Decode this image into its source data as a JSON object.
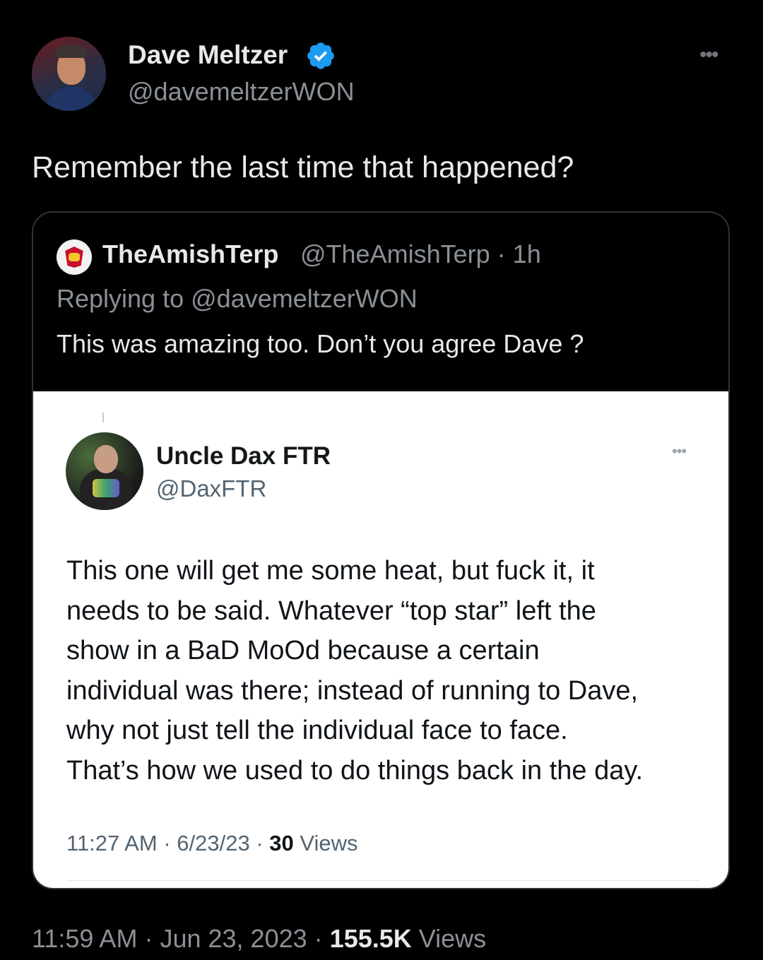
{
  "tweet": {
    "author_name": "Dave Meltzer",
    "author_handle": "@davemeltzerWON",
    "verified": true,
    "text": "Remember the last time that happened?",
    "time": "11:59 AM",
    "date": "Jun 23, 2023",
    "views_count": "155.5K",
    "views_label": "Views",
    "separator": "·"
  },
  "quote": {
    "author_name": "TheAmishTerp",
    "author_handle": "@TheAmishTerp",
    "age": "1h",
    "reply_prefix": "Replying to",
    "reply_to": "@davemeltzerWON",
    "text": "This was amazing too. Don’t you agree Dave ?"
  },
  "embedded": {
    "author_name": "Uncle Dax FTR",
    "author_handle": "@DaxFTR",
    "text": "This one will get me some heat, but fuck it, it\nneeds to be said. Whatever “top star” left the\nshow in a BaD MoOd because a certain\nindividual was there; instead of running to Dave,\nwhy not just tell the individual face to face.\nThat’s how we used to do things back in the day.",
    "time": "11:27 AM",
    "date": "6/23/23",
    "views_count": "30",
    "views_label": "Views"
  },
  "colors": {
    "background": "#000000",
    "verified_badge": "#1d9bf0",
    "secondary_text": "#8b9096"
  },
  "icons": [
    "verified-badge-icon",
    "more-options-icon"
  ]
}
